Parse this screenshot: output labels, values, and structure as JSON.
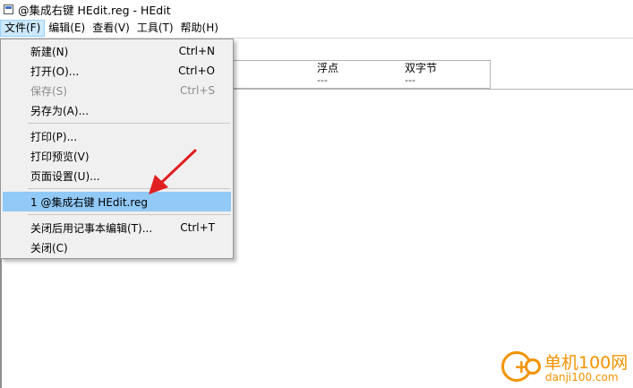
{
  "window": {
    "title": "@集成右键 HEdit.reg - HEdit"
  },
  "menubar": {
    "items": [
      "文件(F)",
      "编辑(E)",
      "查看(V)",
      "工具(T)",
      "帮助(H)"
    ]
  },
  "header": {
    "col_float": "浮点",
    "col_float_val": "---",
    "col_dword": "双字节",
    "col_dword_val": "---"
  },
  "file_menu": {
    "new": {
      "label": "新建(N)",
      "shortcut": "Ctrl+N"
    },
    "open": {
      "label": "打开(O)...",
      "shortcut": "Ctrl+O"
    },
    "save": {
      "label": "保存(S)",
      "shortcut": "Ctrl+S",
      "disabled": true
    },
    "save_as": {
      "label": "另存为(A)..."
    },
    "print": {
      "label": "打印(P)..."
    },
    "print_preview": {
      "label": "打印预览(V)"
    },
    "page_setup": {
      "label": "页面设置(U)..."
    },
    "recent_1": {
      "label": "1 @集成右键 HEdit.reg",
      "highlighted": true
    },
    "close_notepad": {
      "label": "关闭后用记事本编辑(T)...",
      "shortcut": "Ctrl+T"
    },
    "close": {
      "label": "关闭(C)"
    }
  },
  "watermark": {
    "top": "单机100网",
    "bottom": "danji100.com"
  },
  "colors": {
    "highlight": "#91c9f7",
    "arrow": "#e02020",
    "watermark": "#f29300"
  }
}
